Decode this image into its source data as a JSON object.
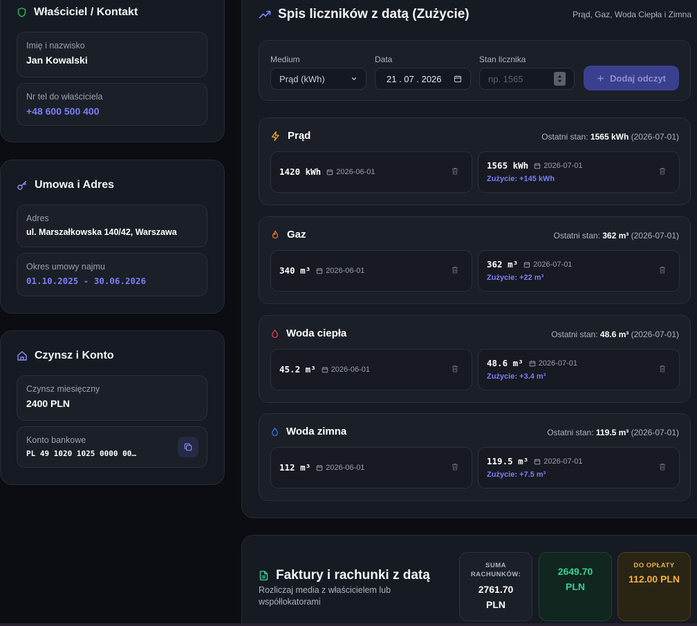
{
  "owner": {
    "title": "Właściciel / Kontakt",
    "name_label": "Imię i nazwisko",
    "name_value": "Jan Kowalski",
    "phone_label": "Nr tel do właściciela",
    "phone_value": "+48 600 500 400"
  },
  "contract": {
    "title": "Umowa i Adres",
    "address_label": "Adres",
    "address_value": "ul. Marszałkowska 140/42, Warszawa",
    "period_label": "Okres umowy najmu",
    "period_value": "01.10.2025 - 30.06.2026"
  },
  "rent": {
    "title": "Czynsz i Konto",
    "rent_label": "Czynsz miesięczny",
    "rent_value": "2400 PLN",
    "account_label": "Konto bankowe",
    "account_value": "PL 49 1020 1025 0000 00…"
  },
  "meters": {
    "title": "Spis liczników z datą (Zużycie)",
    "subtitle": "Prąd, Gaz, Woda Ciepła i Zimna",
    "form": {
      "medium_label": "Medium",
      "medium_value": "Prąd (kWh)",
      "date_label": "Data",
      "date_value": "21 . 07 . 2026",
      "reading_label": "Stan licznika",
      "reading_placeholder": "np. 1565",
      "add_label": "Dodaj odczyt"
    },
    "items": [
      {
        "name": "Prąd",
        "last_prefix": "Ostatni stan:",
        "last_value": "1565 kWh",
        "last_date": "(2026-07-01)",
        "r1_value": "1420 kWh",
        "r1_date": "2026-06-01",
        "r2_value": "1565 kWh",
        "r2_date": "2026-07-01",
        "r2_usage": "Zużycie: +145 kWh",
        "color": "#f5a524"
      },
      {
        "name": "Gaz",
        "last_prefix": "Ostatni stan:",
        "last_value": "362 m³",
        "last_date": "(2026-07-01)",
        "r1_value": "340 m³",
        "r1_date": "2026-06-01",
        "r2_value": "362 m³",
        "r2_date": "2026-07-01",
        "r2_usage": "Zużycie: +22 m³",
        "color": "#f97316"
      },
      {
        "name": "Woda ciepła",
        "last_prefix": "Ostatni stan:",
        "last_value": "48.6 m³",
        "last_date": "(2026-07-01)",
        "r1_value": "45.2 m³",
        "r1_date": "2026-06-01",
        "r2_value": "48.6 m³",
        "r2_date": "2026-07-01",
        "r2_usage": "Zużycie: +3.4 m³",
        "color": "#f43f5e"
      },
      {
        "name": "Woda zimna",
        "last_prefix": "Ostatni stan:",
        "last_value": "119.5 m³",
        "last_date": "(2026-07-01)",
        "r1_value": "112 m³",
        "r1_date": "2026-06-01",
        "r2_value": "119.5 m³",
        "r2_date": "2026-07-01",
        "r2_usage": "Zużycie: +7.5 m³",
        "color": "#3b82f6"
      }
    ]
  },
  "invoices": {
    "title": "Faktury i rachunki z datą",
    "subtitle": "Rozliczaj media z właścicielem lub współlokatorami",
    "sum_label": "SUMA RACHUNKÓW:",
    "sum_value": "2761.70 PLN",
    "paid_value": "2649.70 PLN",
    "due_label": "DO OPŁATY",
    "due_value": "112.00 PLN"
  },
  "colors": {
    "accent": "#7c7ff5",
    "owner_icon": "#22c55e",
    "contract_icon": "#8b8ef7",
    "rent_icon": "#8b8ef7",
    "invoice_icon": "#34d399",
    "trend_icon": "#7c7ff5"
  }
}
